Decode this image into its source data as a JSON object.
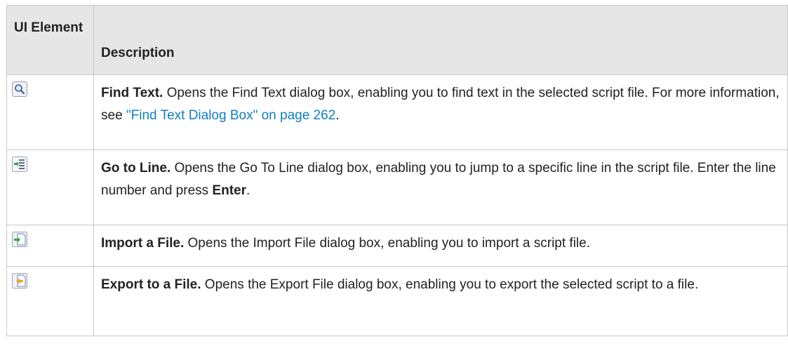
{
  "table": {
    "headers": {
      "element": "UI Element",
      "description": "Description"
    },
    "rows": [
      {
        "icon": "find-text-icon",
        "title": "Find Text.",
        "text_before": " Opens the Find Text dialog box, enabling you to find text in the selected script file. For more information, see ",
        "link": "\"Find Text Dialog Box\" on page 262",
        "text_after": "."
      },
      {
        "icon": "go-to-line-icon",
        "title": "Go to Line.",
        "text_before": " Opens the Go To Line dialog box, enabling you to jump to a specific line in the script file. Enter the line number and press ",
        "bold_key": "Enter",
        "text_after": "."
      },
      {
        "icon": "import-file-icon",
        "title": "Import a File.",
        "text_before": " Opens the Import File dialog box, enabling you to import a script file."
      },
      {
        "icon": "export-file-icon",
        "title": "Export to a File.",
        "text_before": " Opens the Export File dialog box, enabling you to export the selected script to a file."
      }
    ]
  }
}
